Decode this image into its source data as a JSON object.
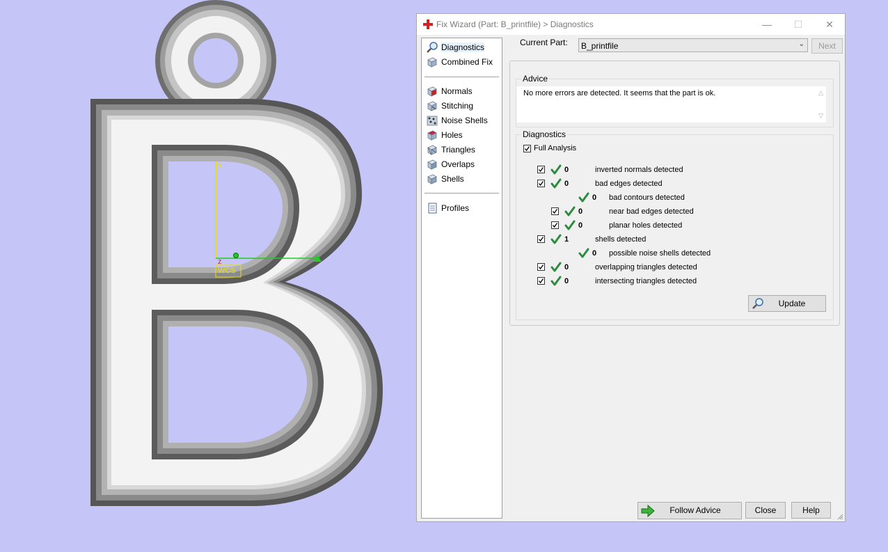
{
  "window": {
    "title": "Fix Wizard (Part: B_printfile) > Diagnostics",
    "controls": [
      "—",
      "☐",
      "✕"
    ]
  },
  "nav": {
    "items": [
      {
        "label": "Diagnostics",
        "icon": "magnifier-icon"
      },
      {
        "label": "Combined Fix",
        "icon": "cube-icon"
      },
      {
        "label": "Normals",
        "icon": "normals-cube-icon"
      },
      {
        "label": "Stitching",
        "icon": "stitching-icon"
      },
      {
        "label": "Noise Shells",
        "icon": "noise-shells-icon"
      },
      {
        "label": "Holes",
        "icon": "holes-icon"
      },
      {
        "label": "Triangles",
        "icon": "triangles-icon"
      },
      {
        "label": "Overlaps",
        "icon": "overlaps-icon"
      },
      {
        "label": "Shells",
        "icon": "shells-icon"
      },
      {
        "label": "Profiles",
        "icon": "document-icon"
      }
    ]
  },
  "current_part": {
    "label": "Current Part:",
    "value": "B_printfile",
    "next_label": "Next"
  },
  "advice": {
    "title": "Advice",
    "text": "No more errors are detected. It seems that the part is ok."
  },
  "diagnostics": {
    "title": "Diagnostics",
    "full_analysis": "Full Analysis",
    "rows": [
      {
        "count": "0",
        "label": "inverted normals detected",
        "checkbox": true,
        "indent": 0
      },
      {
        "count": "0",
        "label": "bad edges detected",
        "checkbox": true,
        "indent": 0
      },
      {
        "count": "0",
        "label": "bad contours detected",
        "checkbox": false,
        "indent": 2
      },
      {
        "count": "0",
        "label": "near bad edges detected",
        "checkbox": true,
        "indent": 1
      },
      {
        "count": "0",
        "label": "planar holes detected",
        "checkbox": true,
        "indent": 1
      },
      {
        "count": "1",
        "label": "shells detected",
        "checkbox": true,
        "indent": 0
      },
      {
        "count": "0",
        "label": "possible noise shells detected",
        "checkbox": false,
        "indent": 2
      },
      {
        "count": "0",
        "label": "overlapping triangles detected",
        "checkbox": true,
        "indent": 0
      },
      {
        "count": "0",
        "label": "intersecting triangles detected",
        "checkbox": true,
        "indent": 0
      }
    ],
    "update_label": "Update"
  },
  "footer": {
    "follow_label": "Follow Advice",
    "close_label": "Close",
    "help_label": "Help"
  },
  "viewport": {
    "axis_y": "y",
    "axis_z": "z",
    "wcs_label": "WCS"
  },
  "colors": {
    "background": "#c5c5f8",
    "check_green": "#2e8b3e",
    "axis_yellow": "#e8e000",
    "axis_green": "#22cc22"
  }
}
